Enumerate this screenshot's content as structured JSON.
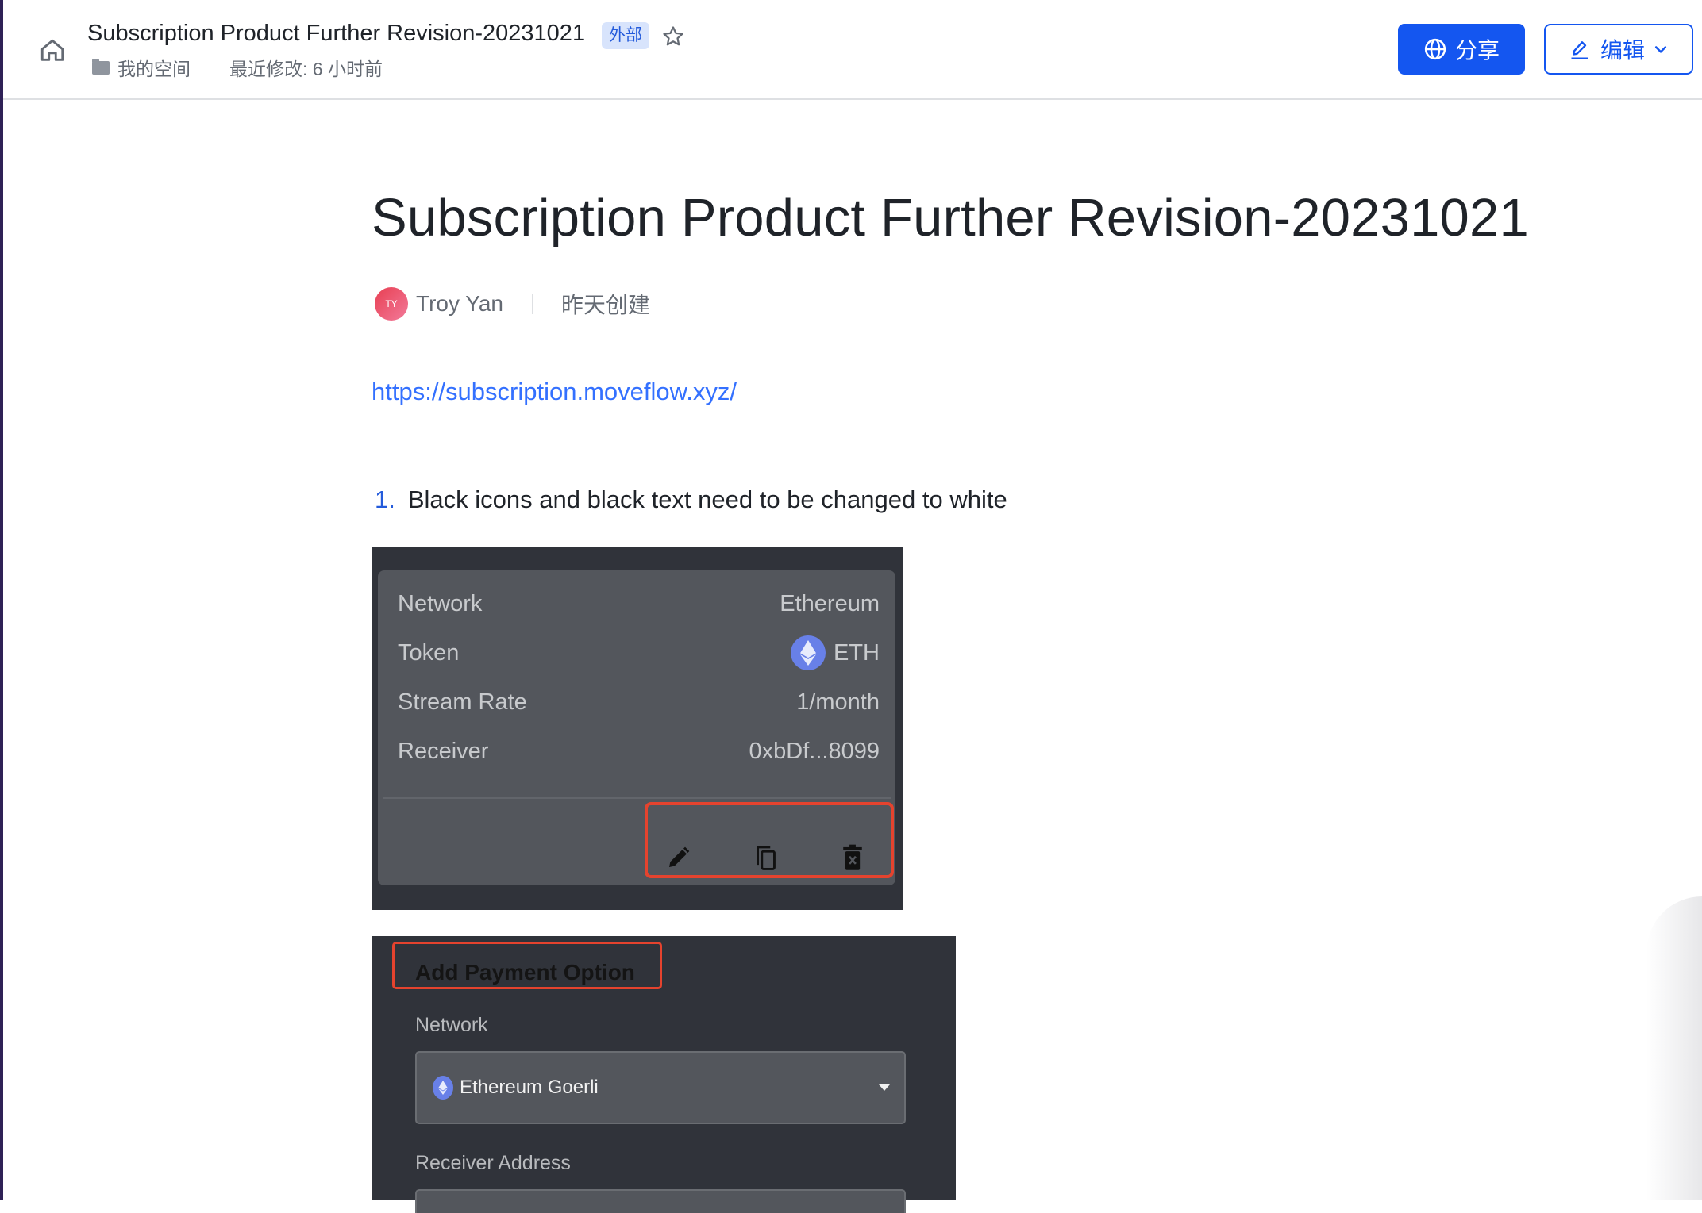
{
  "header": {
    "doc_title": "Subscription Product Further Revision-20231021",
    "badge": "外部",
    "location": "我的空间",
    "last_modified": "最近修改: 6 小时前",
    "share_label": "分享",
    "edit_label": "编辑",
    "icons": {
      "home": "home-icon",
      "star": "star-icon",
      "folder": "folder-icon",
      "share": "globe-icon",
      "edit": "pen-icon",
      "dropdown": "chevron-down-icon"
    }
  },
  "document": {
    "title": "Subscription Product Further Revision-20231021",
    "author": {
      "initials": "TY",
      "name": "Troy Yan",
      "created": "昨天创建"
    },
    "link": "https://subscription.moveflow.xyz/",
    "list": [
      {
        "number": "1.",
        "text": "Black icons and black text need to be changed to white"
      }
    ]
  },
  "embed1": {
    "rows": [
      {
        "label": "Network",
        "value": "Ethereum"
      },
      {
        "label": "Token",
        "value": "ETH",
        "icon": "ethereum-icon"
      },
      {
        "label": "Stream Rate",
        "value": "1/month"
      },
      {
        "label": "Receiver",
        "value": "0xbDf...8099"
      }
    ],
    "actions": [
      "edit-icon",
      "copy-icon",
      "delete-icon"
    ]
  },
  "embed2": {
    "title": "Add Payment Option",
    "network_label": "Network",
    "network_value": "Ethereum Goerli",
    "receiver_label": "Receiver Address"
  },
  "colors": {
    "accent": "#1456f0",
    "link": "#3370ff",
    "highlight_box": "#e5432e",
    "badge_bg": "#d8e4fc"
  }
}
